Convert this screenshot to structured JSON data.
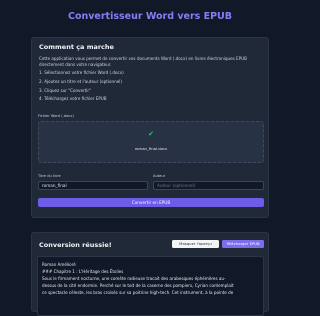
{
  "app": {
    "title": "Convertisseur Word vers EPUB"
  },
  "howto": {
    "heading": "Comment ça marche",
    "intro": "Cette application vous permet de convertir vos documents Word (.docx) en livres électroniques EPUB directement dans votre navigateur.",
    "steps": [
      "1. Sélectionnez votre fichier Word (.docx)",
      "2. Ajoutez un titre et l'auteur (optionnel)",
      "3. Cliquez sur \"Convertir\"",
      "4. Téléchargez votre fichier EPUB"
    ]
  },
  "form": {
    "file_label": "Fichier Word (.docx)",
    "file_name": "roman_final.docx",
    "title_label": "Titre du livre",
    "title_value": "roman_final",
    "author_label": "Auteur",
    "author_placeholder": "Auteur (optionnel)",
    "convert_label": "Convertir en EPUB"
  },
  "result": {
    "heading": "Conversion réussie!",
    "hide_preview_label": "Masquer l'aperçu",
    "download_label": "Télécharger EPUB",
    "preview_lines": [
      "Roman Amélioré",
      "### Chapitre 1 : L'Héritage des Étoiles",
      "Sous le firmament nocturne, une comète radieuse tracait des arabesques éphémères au-",
      "dessus de la cité endormie. Perché sur le toit de la caserne des pompiers, Cyrian contemplait",
      "ce spectacle céleste, les bras croisés sur sa poitrine high-tech. Cet instrument, à la pointe de"
    ]
  },
  "icons": {
    "file_status": "check-icon"
  },
  "colors": {
    "accent": "#6d5ce8",
    "title": "#8b7cf6",
    "success": "#22c55e"
  }
}
